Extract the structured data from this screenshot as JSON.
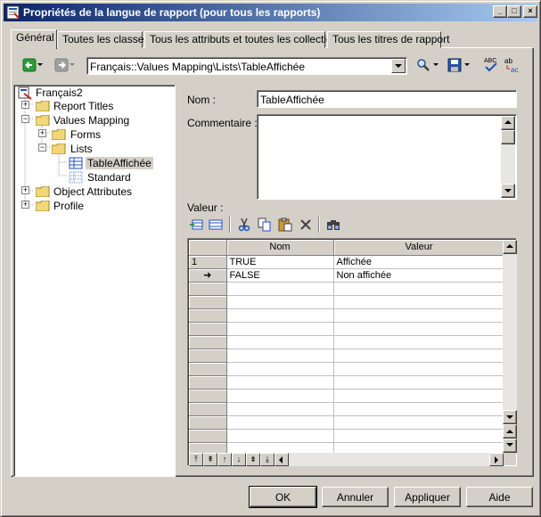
{
  "window": {
    "title": "Propriétés de la langue de rapport (pour tous les rapports)",
    "controls": [
      "_",
      "□",
      "×"
    ]
  },
  "tabs": [
    {
      "label": "Général",
      "active": true
    },
    {
      "label": "Toutes les classes",
      "active": false
    },
    {
      "label": "Tous les attributs et toutes les collections",
      "active": false
    },
    {
      "label": "Tous les titres de rapport",
      "active": false
    }
  ],
  "toolbar": {
    "path": "Français::Values Mapping\\Lists\\TableAffichée",
    "icons": [
      "back-icon",
      "forward-icon",
      "find-icon",
      "save-icon",
      "spellcheck-icon",
      "replace-icon"
    ]
  },
  "tree": {
    "root": "Français2",
    "items": [
      {
        "label": "Report Titles",
        "level": 1,
        "expander": "+"
      },
      {
        "label": "Values Mapping",
        "level": 1,
        "expander": "-"
      },
      {
        "label": "Forms",
        "level": 2,
        "expander": "+"
      },
      {
        "label": "Lists",
        "level": 2,
        "expander": "-"
      },
      {
        "label": "TableAffichée",
        "level": 3,
        "selected": true
      },
      {
        "label": "Standard",
        "level": 3
      },
      {
        "label": "Object Attributes",
        "level": 1,
        "expander": "+"
      },
      {
        "label": "Profile",
        "level": 1,
        "expander": "+"
      }
    ]
  },
  "form": {
    "name_label": "Nom :",
    "name_value": "TableAffichée",
    "comment_label": "Commentaire :",
    "comment_value": "",
    "value_label": "Valeur :"
  },
  "grid": {
    "columns": [
      "Nom",
      "Valeur"
    ],
    "rows": [
      {
        "marker": "1",
        "nom": "TRUE",
        "valeur": "Affichée"
      },
      {
        "marker": "➜",
        "nom": "FALSE",
        "valeur": "Non affichée"
      }
    ],
    "empty_rows": 13
  },
  "buttons": {
    "ok": "OK",
    "cancel": "Annuler",
    "apply": "Appliquer",
    "help": "Aide"
  },
  "colors": {
    "title_start": "#0a246a",
    "title_end": "#a6caf0",
    "face": "#d4d0c8",
    "folder": "#f2d77a"
  }
}
